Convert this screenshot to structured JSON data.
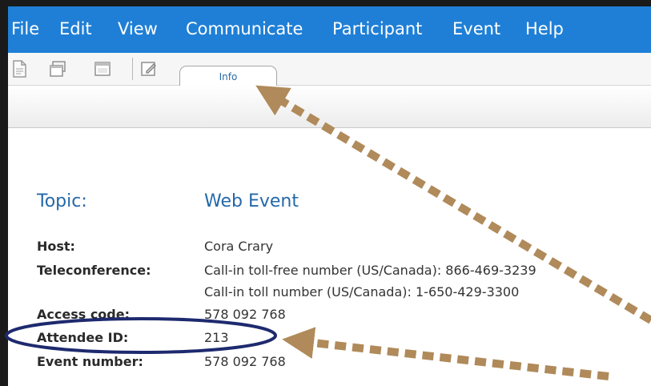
{
  "menu": {
    "items": [
      "File",
      "Edit",
      "View",
      "Communicate",
      "Participant",
      "Event",
      "Help"
    ]
  },
  "toolbar": {
    "icons": [
      "new-document-icon",
      "windows-icon",
      "window-icon",
      "edit-icon"
    ]
  },
  "tabs": [
    {
      "label": "Info"
    }
  ],
  "info": {
    "topic_label": "Topic:",
    "topic_value": "Web Event",
    "host_label": "Host:",
    "host_value": "Cora Crary",
    "teleconference_label": "Teleconference:",
    "teleconference_lines": [
      "Call-in toll-free number (US/Canada):  866-469-3239",
      "Call-in toll number (US/Canada):  1-650-429-3300"
    ],
    "access_code_label": "Access code:",
    "access_code_value": "578 092 768",
    "attendee_id_label": "Attendee ID:",
    "attendee_id_value": "213",
    "event_number_label": "Event number:",
    "event_number_value": "578 092 768"
  },
  "colors": {
    "menu_bar": "#1f7fd6",
    "topic_text": "#2568a8",
    "arrow": "#b08a5a",
    "highlight_oval": "#1e2a6e"
  }
}
